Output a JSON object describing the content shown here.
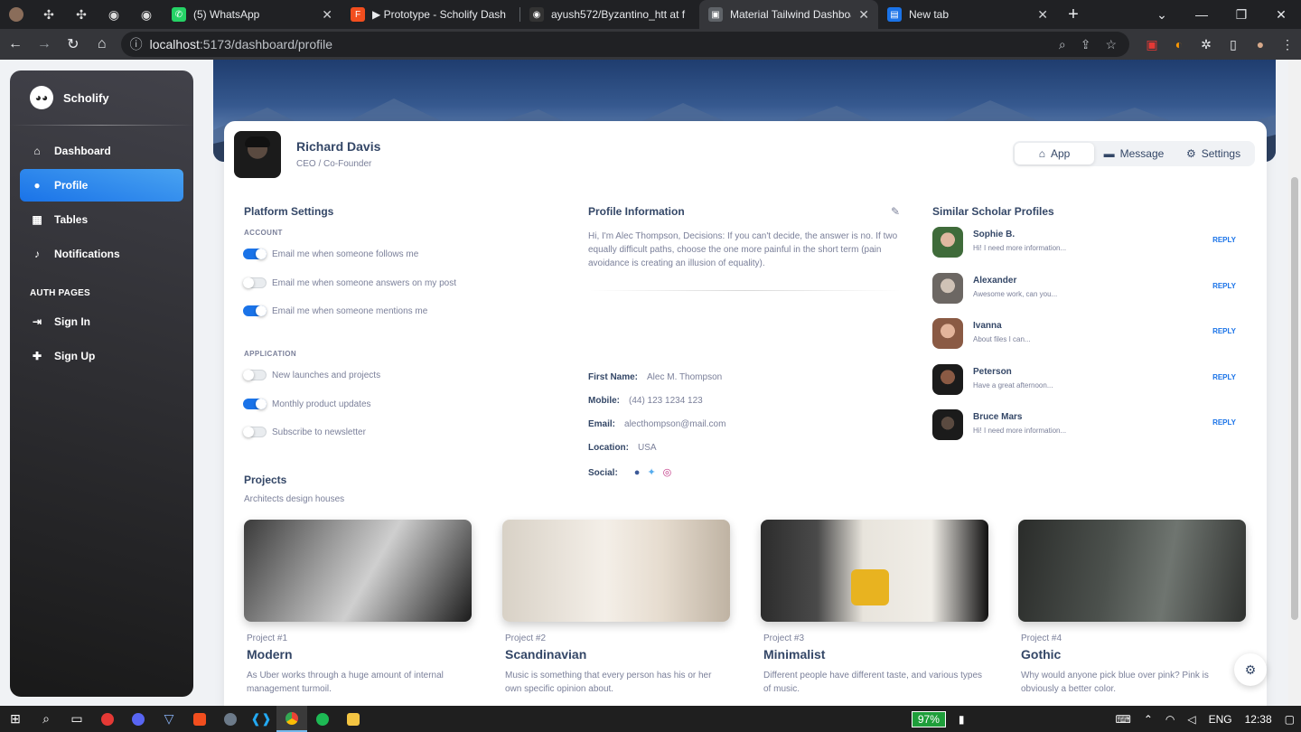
{
  "browser": {
    "tabs": [
      {
        "title": "(5) WhatsApp",
        "fav_color": "#25D366",
        "icon": "whatsapp-icon"
      },
      {
        "title": "▶ Prototype - Scholify Dash",
        "fav_color": "#F24E1E",
        "icon": "figma-icon"
      },
      {
        "title": "ayush572/Byzantino_htt at f",
        "fav_color": "#333333",
        "icon": "github-icon"
      },
      {
        "title": "Material Tailwind Dashboard",
        "fav_color": "#5f6368",
        "icon": "page-icon",
        "active": true
      },
      {
        "title": "New tab",
        "fav_color": "#1a73e8",
        "icon": "newtab-icon"
      }
    ],
    "url_host": "localhost",
    "url_path": ":5173/dashboard/profile"
  },
  "sidebar": {
    "brand": "Scholify",
    "items": [
      {
        "label": "Dashboard",
        "icon": "home-icon",
        "glyph": "⌂"
      },
      {
        "label": "Profile",
        "icon": "user-circle-icon",
        "glyph": "●",
        "active": true
      },
      {
        "label": "Tables",
        "icon": "table-icon",
        "glyph": "▦"
      },
      {
        "label": "Notifications",
        "icon": "bell-icon",
        "glyph": "♪"
      }
    ],
    "auth_section": "AUTH PAGES",
    "auth_items": [
      {
        "label": "Sign In",
        "icon": "sign-in-icon",
        "glyph": "⇥"
      },
      {
        "label": "Sign Up",
        "icon": "user-plus-icon",
        "glyph": "✚"
      }
    ]
  },
  "profile": {
    "name": "Richard Davis",
    "role": "CEO / Co-Founder",
    "tabs": {
      "app": "App",
      "message": "Message",
      "settings": "Settings"
    }
  },
  "platform_settings": {
    "title": "Platform Settings",
    "account_label": "ACCOUNT",
    "account": [
      {
        "label": "Email me when someone follows me",
        "on": true
      },
      {
        "label": "Email me when someone answers on my post",
        "on": false
      },
      {
        "label": "Email me when someone mentions me",
        "on": true
      }
    ],
    "application_label": "APPLICATION",
    "application": [
      {
        "label": "New launches and projects",
        "on": false
      },
      {
        "label": "Monthly product updates",
        "on": true
      },
      {
        "label": "Subscribe to newsletter",
        "on": false
      }
    ]
  },
  "profile_info": {
    "title": "Profile Information",
    "bio": "Hi, I'm Alec Thompson, Decisions: If you can't decide, the answer is no. If two equally difficult paths, choose the one more painful in the short term (pain avoidance is creating an illusion of equality).",
    "first_name_label": "First Name:",
    "first_name": "Alec M. Thompson",
    "mobile_label": "Mobile:",
    "mobile": "(44) 123 1234 123",
    "email_label": "Email:",
    "email": "alecthompson@mail.com",
    "location_label": "Location:",
    "location": "USA",
    "social_label": "Social:"
  },
  "similar": {
    "title": "Similar Scholar Profiles",
    "people": [
      {
        "name": "Sophie B.",
        "msg": "Hi! I need more information...",
        "action": "REPLY",
        "color": "#3f6b3a"
      },
      {
        "name": "Alexander",
        "msg": "Awesome work, can you...",
        "action": "REPLY",
        "color": "#b9b1a8"
      },
      {
        "name": "Ivanna",
        "msg": "About files I can...",
        "action": "REPLY",
        "color": "#8a5a44"
      },
      {
        "name": "Peterson",
        "msg": "Have a great afternoon...",
        "action": "REPLY",
        "color": "#4a2e22"
      },
      {
        "name": "Bruce Mars",
        "msg": "Hi! I need more information...",
        "action": "REPLY",
        "color": "#2b2b2b"
      }
    ]
  },
  "projects": {
    "title": "Projects",
    "subtitle": "Architects design houses",
    "items": [
      {
        "num": "Project #1",
        "name": "Modern",
        "desc": "As Uber works through a huge amount of internal management turmoil.",
        "bg": "linear-gradient(120deg,#3a3a3a 0%,#9a9a9a 35%,#cfcfcf 55%,#1b1b1b 100%)"
      },
      {
        "num": "Project #2",
        "name": "Scandinavian",
        "desc": "Music is something that every person has his or her own specific opinion about.",
        "bg": "linear-gradient(90deg,#d8d1c6 0%,#f4efe8 45%,#e6dccf 70%,#bfb3a3 100%)"
      },
      {
        "num": "Project #3",
        "name": "Minimalist",
        "desc": "Different people have different taste, and various types of music.",
        "bg": "linear-gradient(90deg,#2c2c2c 0%,#4a4a4a 25%,#e8e4dc 45%,#f1eee8 75%,#111 100%)"
      },
      {
        "num": "Project #4",
        "name": "Gothic",
        "desc": "Why would anyone pick blue over pink? Pink is obviously a better color.",
        "bg": "linear-gradient(100deg,#2a2c2a 0%,#4c514d 40%,#6f7570 65%,#2f312f 100%)"
      }
    ]
  },
  "taskbar": {
    "battery": "97%",
    "lang": "ENG",
    "time": "12:38"
  }
}
